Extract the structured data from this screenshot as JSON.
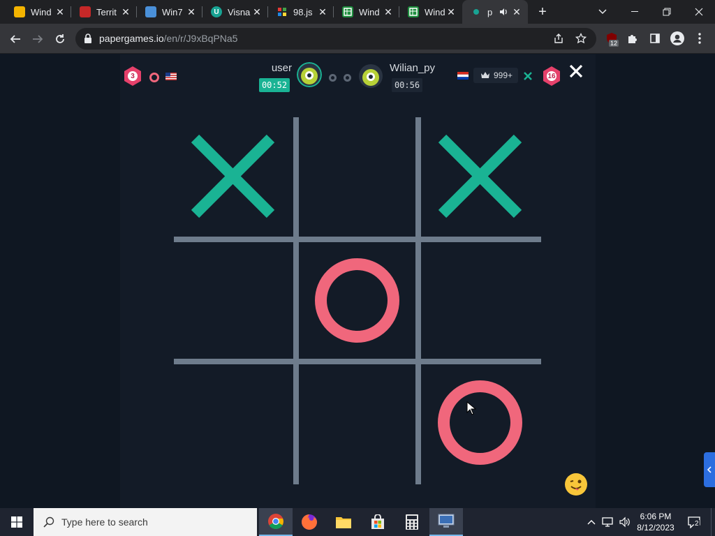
{
  "browser": {
    "tabs": [
      {
        "label": "Wind",
        "icon": "window-doc-icon",
        "color": "#f4b400"
      },
      {
        "label": "Territ",
        "icon": "territory-map-icon",
        "color": "#c62828"
      },
      {
        "label": "Win7",
        "icon": "win7-app-icon",
        "color": "#4a90d9"
      },
      {
        "label": "Visna",
        "icon": "u-logo-icon",
        "color": "#18a393"
      },
      {
        "label": "98.js",
        "icon": "win98-logo-icon",
        "color": "#6a5acd"
      },
      {
        "label": "Wind",
        "icon": "sheet-icon",
        "color": "#1e8e3e"
      },
      {
        "label": "Wind",
        "icon": "sheet-icon",
        "color": "#1e8e3e"
      },
      {
        "label": "p",
        "icon": "papergames-dot-icon",
        "color": "#18a393",
        "active": true
      }
    ],
    "url_host": "papergames.io",
    "url_path": "/en/r/J9xBqPNa5",
    "extension_badge": "12"
  },
  "game": {
    "left_player": {
      "name": "user",
      "timer": "00:52",
      "level": "3",
      "symbol": "O",
      "timer_color": "#1ab394"
    },
    "right_player": {
      "name": "Wilian_py",
      "timer": "00:56",
      "level": "16",
      "symbol": "X",
      "rank": "999+"
    },
    "score": [
      "0",
      "0"
    ],
    "board": [
      [
        "X",
        "",
        "X"
      ],
      [
        "",
        "O",
        ""
      ],
      [
        "",
        "",
        "O"
      ]
    ],
    "colors": {
      "x": "#1ab394",
      "o": "#f0677c",
      "grid": "#6e7c8c"
    }
  },
  "taskbar": {
    "search_placeholder": "Type here to search",
    "time": "6:06 PM",
    "date": "8/12/2023",
    "notification_count": "2"
  }
}
